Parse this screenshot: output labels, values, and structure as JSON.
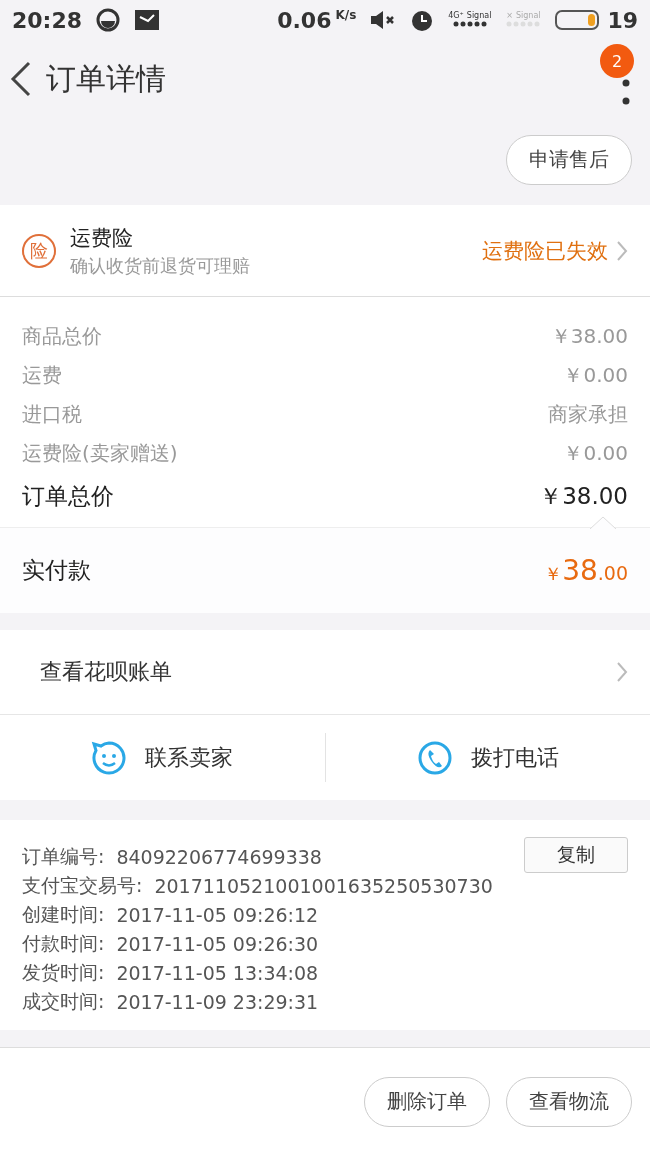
{
  "status_bar": {
    "time": "20:28",
    "speed": "0.06",
    "speed_unit": "K/s",
    "sim1_label": "4G⁺",
    "sim1_signal": "Signal",
    "sim2_mark": "×",
    "sim2_signal": "Signal",
    "battery": "19"
  },
  "header": {
    "title": "订单详情",
    "badge": "2"
  },
  "after_sale_button": "申请售后",
  "insurance": {
    "icon_text": "险",
    "title": "运费险",
    "subtitle": "确认收货前退货可理赔",
    "status": "运费险已失效"
  },
  "price_rows": [
    {
      "label": "商品总价",
      "value": "￥38.00",
      "kind": "minor"
    },
    {
      "label": "运费",
      "value": "￥0.00",
      "kind": "minor"
    },
    {
      "label": "进口税",
      "value": "商家承担",
      "kind": "minor"
    },
    {
      "label": "运费险(卖家赠送)",
      "value": "￥0.00",
      "kind": "minor"
    },
    {
      "label": "订单总价",
      "value": "￥38.00",
      "kind": "total"
    }
  ],
  "paid": {
    "label": "实付款",
    "currency": "￥",
    "whole": "38",
    "fraction": ".00"
  },
  "huabei": {
    "label": "查看花呗账单"
  },
  "contact": [
    {
      "label": "联系卖家",
      "kind": "chat"
    },
    {
      "label": "拨打电话",
      "kind": "phone"
    }
  ],
  "order_info": [
    {
      "label": "订单编号:",
      "value": "84092206774699338",
      "copy": "复制"
    },
    {
      "label": "支付宝交易号:",
      "value": "2017110521001001635250530730"
    },
    {
      "label": "创建时间:",
      "value": "2017-11-05 09:26:12"
    },
    {
      "label": "付款时间:",
      "value": "2017-11-05 09:26:30"
    },
    {
      "label": "发货时间:",
      "value": "2017-11-05 13:34:08"
    },
    {
      "label": "成交时间:",
      "value": "2017-11-09 23:29:31"
    }
  ],
  "bottom_buttons": [
    "删除订单",
    "查看物流"
  ]
}
